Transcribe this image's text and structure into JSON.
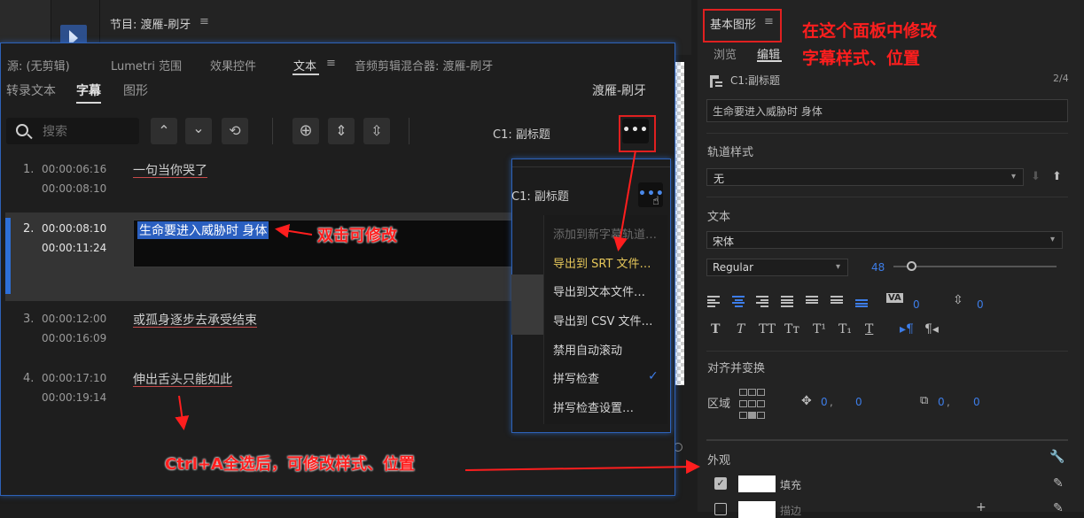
{
  "program_monitor": {
    "title": "节目: 渡雁-刷牙",
    "menu_icon": "≡"
  },
  "panel_tabs": [
    {
      "label": "源: (无剪辑)"
    },
    {
      "label": "Lumetri 范围"
    },
    {
      "label": "效果控件"
    },
    {
      "label": "文本"
    },
    {
      "label": "≡"
    },
    {
      "label": "音频剪辑混合器: 渡雁-刷牙"
    }
  ],
  "sub_tabs": [
    {
      "label": "转录文本"
    },
    {
      "label": "字幕"
    },
    {
      "label": "图形"
    }
  ],
  "sequence_name": "渡雁-刷牙",
  "toolbar": {
    "search_placeholder": "搜索",
    "track_label": "C1: 副标题",
    "more_label": "•••"
  },
  "captions": [
    {
      "index": "1.",
      "start": "00:00:06:16",
      "end": "00:00:08:10",
      "text": "一句当你哭了"
    },
    {
      "index": "2.",
      "start": "00:00:08:10",
      "end": "00:00:11:24",
      "text": "生命要进入威胁时 身体"
    },
    {
      "index": "3.",
      "start": "00:00:12:00",
      "end": "00:00:16:09",
      "text": "或孤身逐步去承受结束"
    },
    {
      "index": "4.",
      "start": "00:00:17:10",
      "end": "00:00:19:14",
      "text": "伸出舌头只能如此"
    }
  ],
  "popup": {
    "track_label": "C1: 副标题",
    "more_label": "•••",
    "items": [
      {
        "label": "添加到新字幕轨道…",
        "state": "disabled"
      },
      {
        "label": "导出到 SRT 文件…",
        "state": "highlight"
      },
      {
        "label": "导出到文本文件…",
        "state": "normal"
      },
      {
        "label": "导出到 CSV 文件…",
        "state": "normal"
      },
      {
        "label": "禁用自动滚动",
        "state": "normal"
      },
      {
        "label": "拼写检查",
        "state": "checked"
      },
      {
        "label": "拼写检查设置…",
        "state": "normal"
      }
    ],
    "check_icon": "✓"
  },
  "essential_graphics": {
    "title": "基本图形",
    "menu_icon": "≡",
    "tabs": {
      "browse": "浏览",
      "edit": "编辑"
    },
    "layer": {
      "name": "C1:副标题",
      "count": "2/4"
    },
    "text_value": "生命要进入威胁时 身体",
    "track_style": {
      "label": "轨道样式",
      "value": "无"
    },
    "text_section": {
      "label": "文本",
      "font": "宋体",
      "weight": "Regular",
      "size": "48",
      "tracking": "0",
      "leading": "0",
      "tracking_icon": "VA"
    },
    "align_transform": {
      "label": "对齐并变换",
      "region_label": "区域",
      "position": [
        "0",
        "0"
      ],
      "scale": [
        "0",
        "0"
      ]
    },
    "appearance": {
      "label": "外观",
      "fill_label": "填充",
      "fill_color": "#ffffff",
      "stroke_label": "描边"
    }
  },
  "annotations": {
    "panel_note_line1": "在这个面板中修改",
    "panel_note_line2": "字幕样式、位置",
    "dblclick_note": "双击可修改",
    "ctrl_note": "Ctrl+A全选后，可修改样式、位置"
  },
  "colors": {
    "accent_blue": "#2d6fd8",
    "annotation_red": "#ff1e1e",
    "highlight_yellow": "#e6c75a"
  }
}
